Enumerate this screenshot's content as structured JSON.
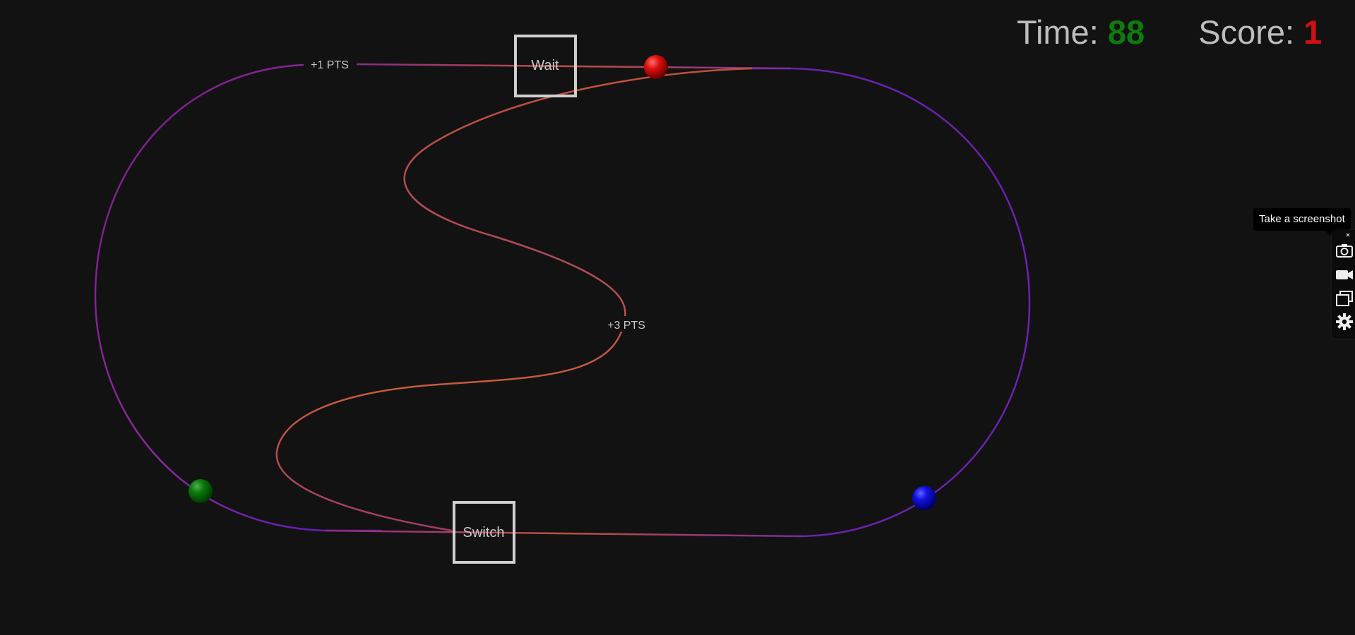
{
  "hud": {
    "time_label": "Time:",
    "time_value": "88",
    "score_label": "Score:",
    "score_value": "1"
  },
  "track": {
    "outer_label": "+1 PTS",
    "inner_label": "+3 PTS"
  },
  "boxes": {
    "wait_label": "Wait",
    "switch_label": "Switch"
  },
  "balls": [
    {
      "name": "red-ball",
      "color": "#e01010"
    },
    {
      "name": "green-ball",
      "color": "#0a7a0a"
    },
    {
      "name": "blue-ball",
      "color": "#1010e0"
    }
  ],
  "toolbar": {
    "tooltip": "Take a screenshot",
    "icons": [
      "camera-icon",
      "video-camera-icon",
      "windows-icon",
      "gear-icon"
    ]
  },
  "colors": {
    "background": "#121212",
    "track_purple": "#6a1a9a",
    "track_orange": "#d0603a",
    "time_green": "#0f7a0f",
    "score_red": "#d01010"
  }
}
